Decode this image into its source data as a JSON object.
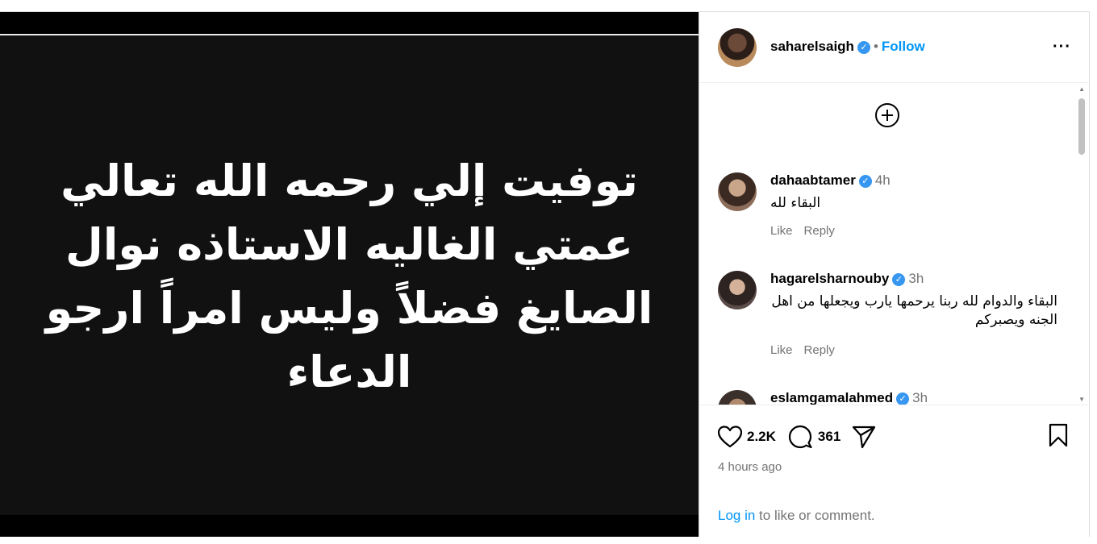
{
  "post": {
    "media_text": "توفيت إلي رحمه الله تعالي عمتي الغاليه الاستاذه نوال الصايغ فضلاً وليس امراً ارجو الدعاء"
  },
  "header": {
    "username": "saharelsaigh",
    "separator": "•",
    "follow_label": "Follow",
    "more_label": "···"
  },
  "comments": [
    {
      "username": "dahaabtamer",
      "time": "4h",
      "text": "البقاء لله",
      "like_label": "Like",
      "reply_label": "Reply"
    },
    {
      "username": "hagarelsharnouby",
      "time": "3h",
      "text": "البقاء والدوام لله ربنا يرحمها يارب ويجعلها من اهل الجنه ويصبركم",
      "like_label": "Like",
      "reply_label": "Reply"
    },
    {
      "username": "eslamgamalahmed",
      "time": "3h",
      "text": ""
    }
  ],
  "footer": {
    "likes_count": "2.2K",
    "comments_count": "361",
    "time_ago": "4 hours ago",
    "login_link": "Log in",
    "login_rest": " to like or comment."
  },
  "colors": {
    "accent": "#0095f6",
    "verified": "#3797f0",
    "muted": "#737373",
    "media_bg": "#111111"
  },
  "icons": [
    "plus-circle-icon",
    "verified-badge-icon",
    "heart-icon",
    "comment-icon",
    "share-icon",
    "bookmark-icon",
    "more-options-icon"
  ]
}
